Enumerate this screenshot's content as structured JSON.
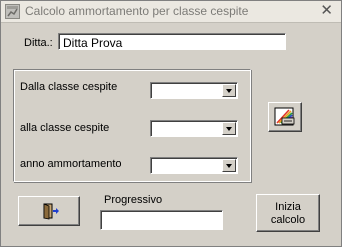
{
  "window": {
    "title": "Calcolo ammortamento per classe cespite"
  },
  "form": {
    "ditta_label": "Ditta.:",
    "ditta_value": "Ditta Prova",
    "dalla_label": "Dalla classe cespite",
    "dalla_value": "",
    "alla_label": "alla classe  cespite",
    "alla_value": "",
    "anno_label": "anno ammortamento",
    "anno_value": "",
    "progressivo_label": "Progressivo",
    "progressivo_value": ""
  },
  "buttons": {
    "inizia_line1": "Inizia",
    "inizia_line2": "calcolo"
  },
  "icons": {
    "app": "app-icon",
    "close": "close-icon",
    "report": "report-chart-icon",
    "exit": "exit-door-icon"
  }
}
